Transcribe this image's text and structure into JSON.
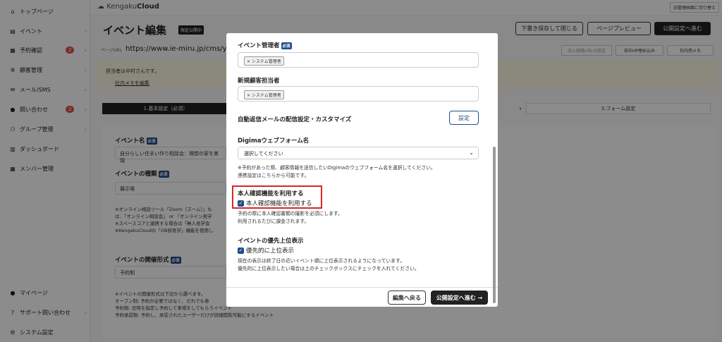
{
  "sidebar": {
    "items": [
      {
        "label": "トップページ",
        "icon": "home-icon"
      },
      {
        "label": "イベント",
        "icon": "document-icon"
      },
      {
        "label": "予約確認",
        "icon": "calendar-icon",
        "badge": "2"
      },
      {
        "label": "顧客管理",
        "icon": "users-icon"
      },
      {
        "label": "メール/SMS",
        "icon": "mail-icon"
      },
      {
        "label": "問い合わせ",
        "icon": "chat-icon",
        "badge": "2"
      },
      {
        "label": "グループ管理",
        "icon": "group-icon"
      },
      {
        "label": "ダッシュボード",
        "icon": "dashboard-icon"
      },
      {
        "label": "メンバー管理",
        "icon": "members-icon"
      }
    ],
    "bottom": [
      {
        "label": "マイページ",
        "icon": "person-icon"
      },
      {
        "label": "サポート問い合わせ",
        "icon": "help-icon"
      },
      {
        "label": "システム設定",
        "icon": "gear-icon"
      }
    ]
  },
  "topbar": {
    "logo_prefix": "Kengaku",
    "logo_bold": "Cloud",
    "switch_label": "旧管理画面に切り替え"
  },
  "header": {
    "title": "イベント編集",
    "status_badge": "限定公開中",
    "save_close": "下書き保存して閉じる",
    "preview": "ページプレビュー",
    "proceed": "公開設定へ進む"
  },
  "url_bar": {
    "label": "ページURL",
    "value": "https://www.ie-miru.jp/cms/yo",
    "btn1": "流入経路URLの設定",
    "btn2": "自社HP埋め込み",
    "btn3": "社内用メモ"
  },
  "memo": {
    "text": "担当者は中村さんです。",
    "link": "社内メモを編集"
  },
  "steps": {
    "step1": "1.基本設定（必須）",
    "step3": "3.フォーム設定"
  },
  "background_form": {
    "event_name_label": "イベント名",
    "required": "必須",
    "event_name_value": "自分らしい住まい作り相談会：理想の家を実現",
    "event_type_label": "イベントの種類",
    "event_type_value": "展示場",
    "notes1": [
      "※オンライン相談ツール「Zoom（ズーム）」も",
      "は、「オンライン相談会」 or 「オンライン見学",
      "※スペースコアと連携する場合は「無人見学会",
      "※KengakuCloudの「OB邸見学」機能を使用し"
    ],
    "format_label": "イベントの開催形式",
    "format_value": "予約制",
    "notes2": [
      "※イベントの開催形式は下記から選べます。",
      "オープン制: 予約が必要ではなく、だれでも参",
      "予約制: 日時を指定し予約して来場をしてもらうイベント",
      "予約承認制: 予約し、承認されたユーザーだけが詳細閲覧可能にするイベント"
    ]
  },
  "modal": {
    "manager_label": "イベント管理者",
    "required": "必須",
    "manager_chip": "× システム管理者",
    "new_customer_label": "新規顧客担当者",
    "new_customer_chip": "× システム管理者",
    "auto_mail_label": "自動返信メールの配信設定・カスタマイズ",
    "settings_button": "設定",
    "digima_label": "Digimaウェブフォーム名",
    "digima_select": "選択してください",
    "digima_note1": "※予約があった際、顧客情報を送信したいDigimaのウェブフォーム名を選択してください。",
    "digima_note2_pre": "連携設定は",
    "digima_note2_link": "こちら",
    "digima_note2_post": "から可能です。",
    "identity_label": "本人確認機能を利用する",
    "identity_checkbox": "本人確認機能を利用する",
    "identity_note1": "予約の際に本人確認書類の撮影を必須にします。",
    "identity_note2": "利用されるたびに課金されます。",
    "priority_label": "イベントの優先上位表示",
    "priority_checkbox": "優先的に上位表示",
    "priority_note1": "現在の表示は終了日の近いイベント順に上位表示されるようになっています。",
    "priority_note2": "優先的に上位表示したい場合は上のチェックボックスにチェックを入れてください。",
    "back_button": "編集へ戻る",
    "next_button": "公開設定へ進む →"
  }
}
